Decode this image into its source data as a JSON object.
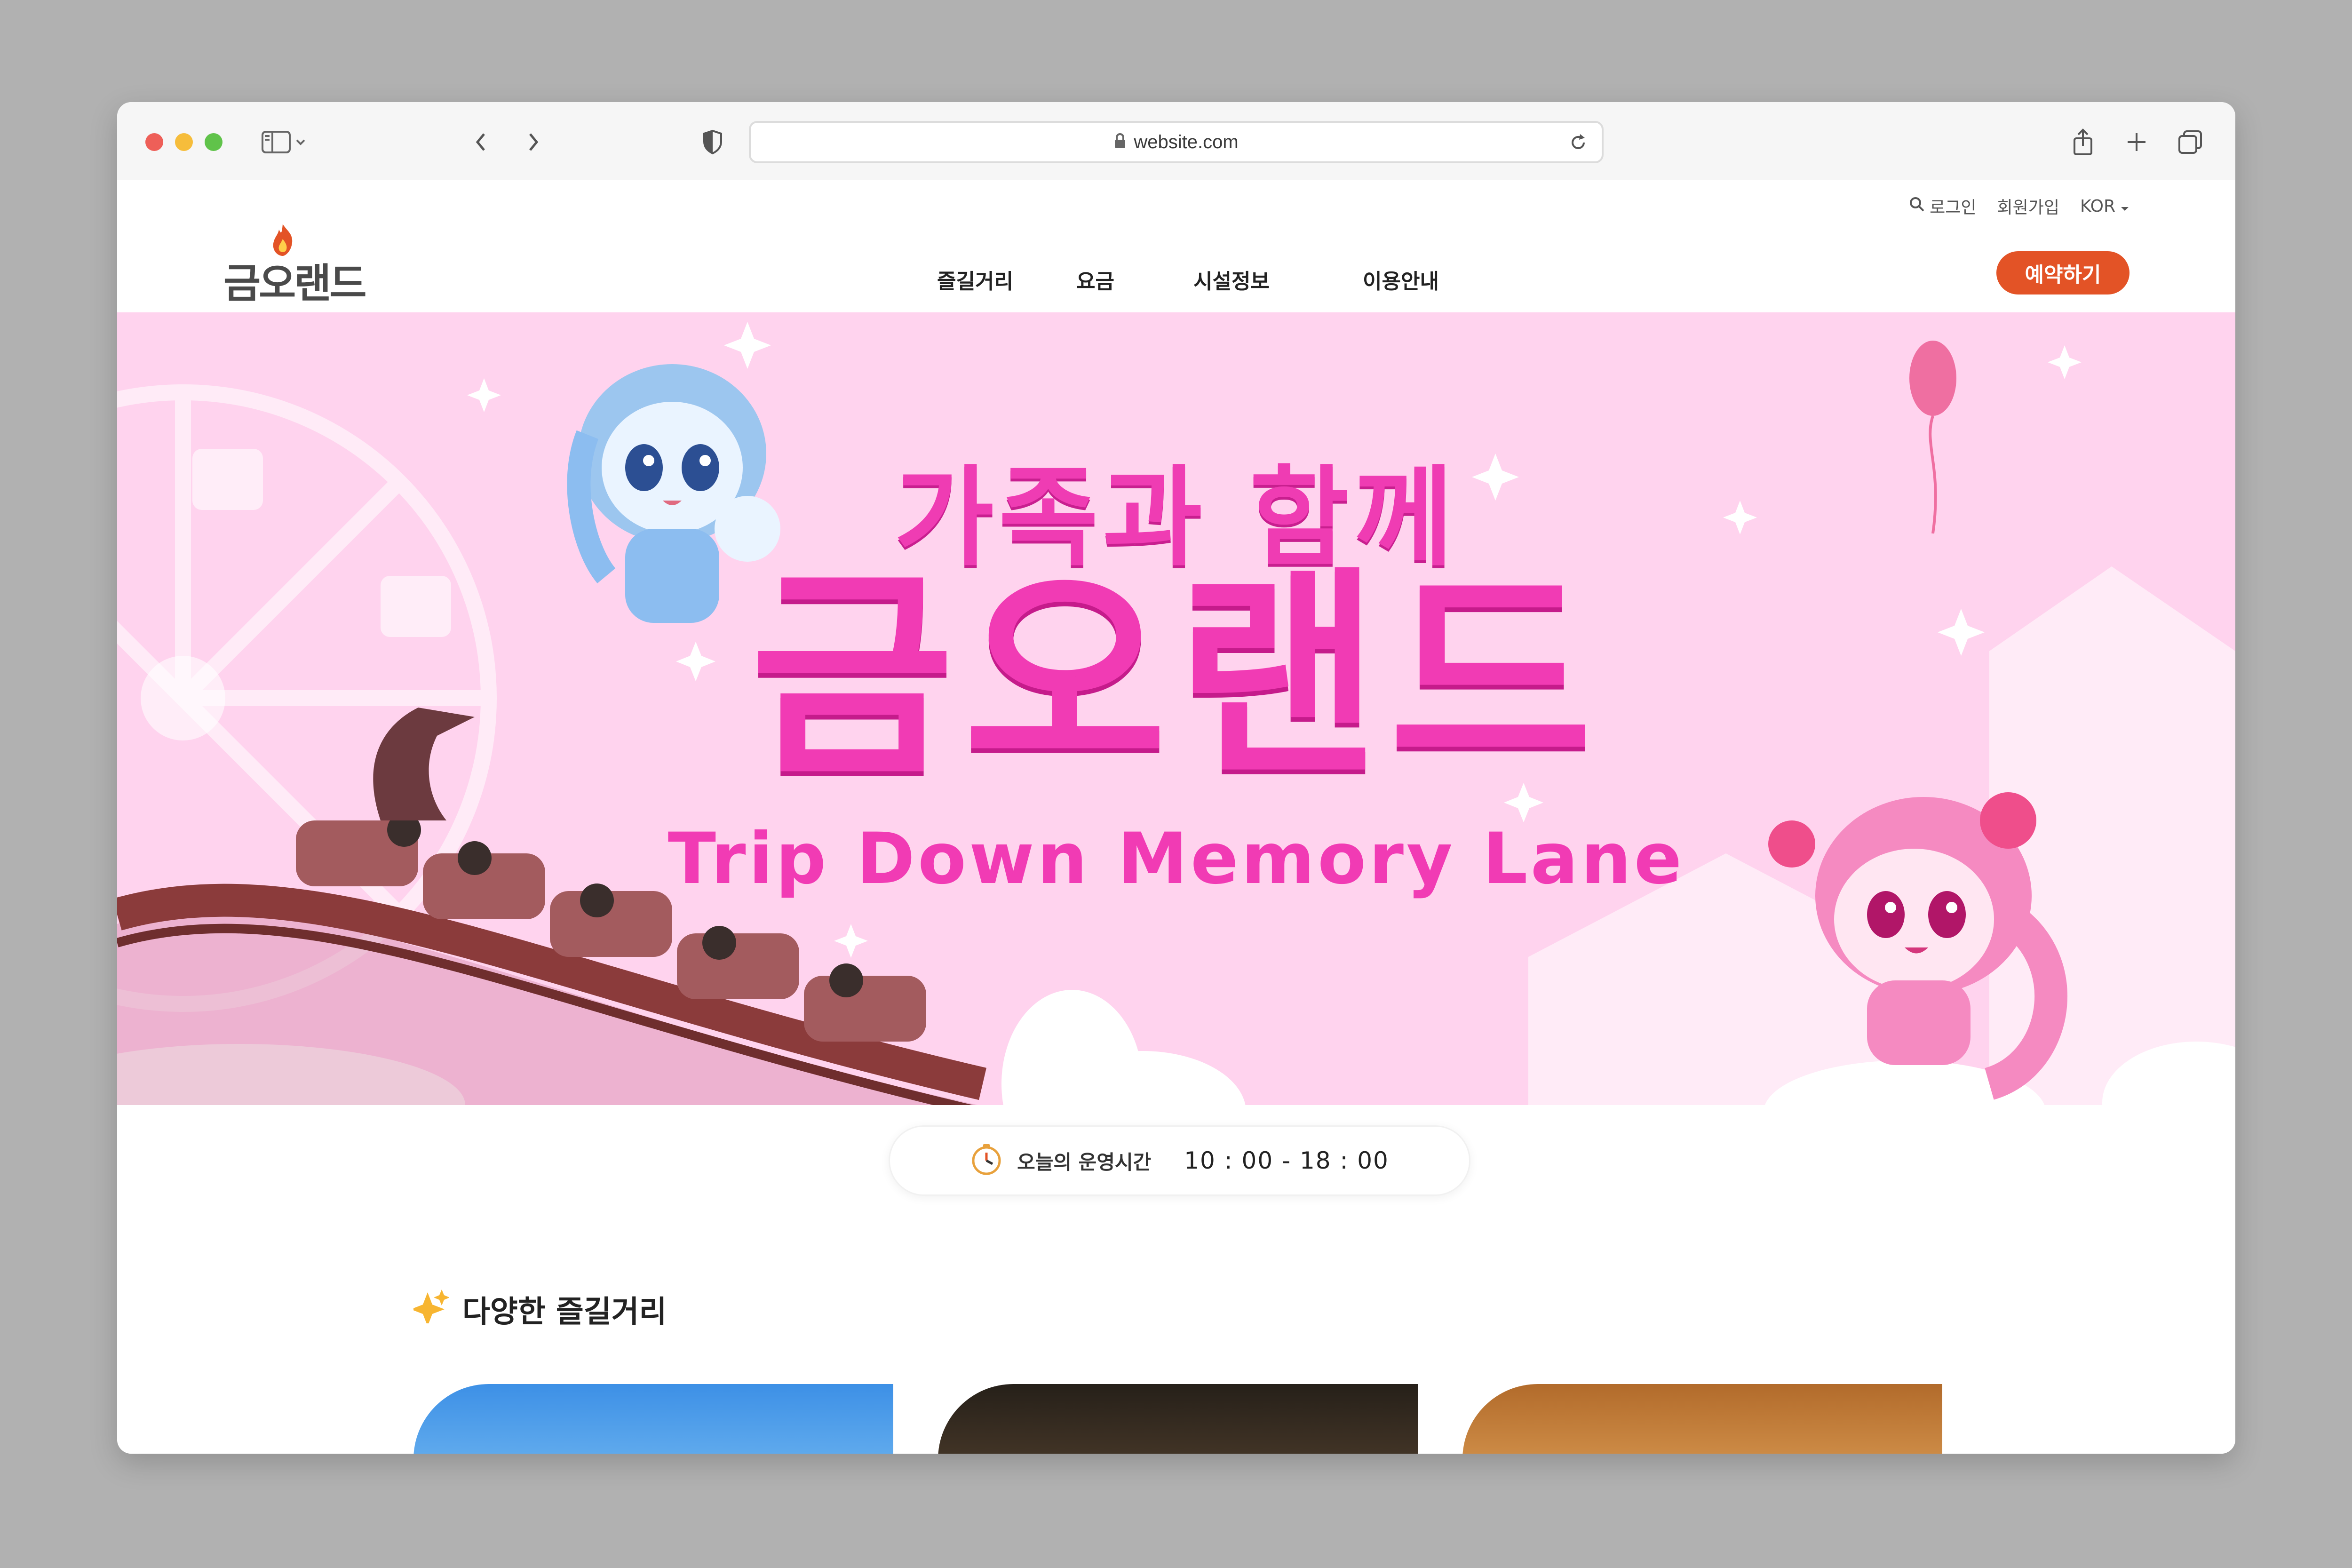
{
  "browser": {
    "url": "website.com"
  },
  "header": {
    "logo_text": "금오랜드",
    "utility": {
      "login": "로그인",
      "signup": "회원가입",
      "language": "KOR"
    },
    "nav": [
      "즐길거리",
      "요금",
      "시설정보",
      "이용안내"
    ],
    "reserve_label": "예약하기"
  },
  "hero": {
    "subtitle": "가족과 함께",
    "title": "금오랜드",
    "tagline": "Trip Down Memory Lane"
  },
  "hours": {
    "label": "오늘의 운영시간",
    "time": "10 : 00 - 18 : 00"
  },
  "section": {
    "title": "다양한 즐길거리",
    "icon": "sparkles-icon"
  },
  "colors": {
    "accent": "#e35326",
    "hero_bg": "#ffd3ee",
    "hero_text": "#f13bb4"
  }
}
